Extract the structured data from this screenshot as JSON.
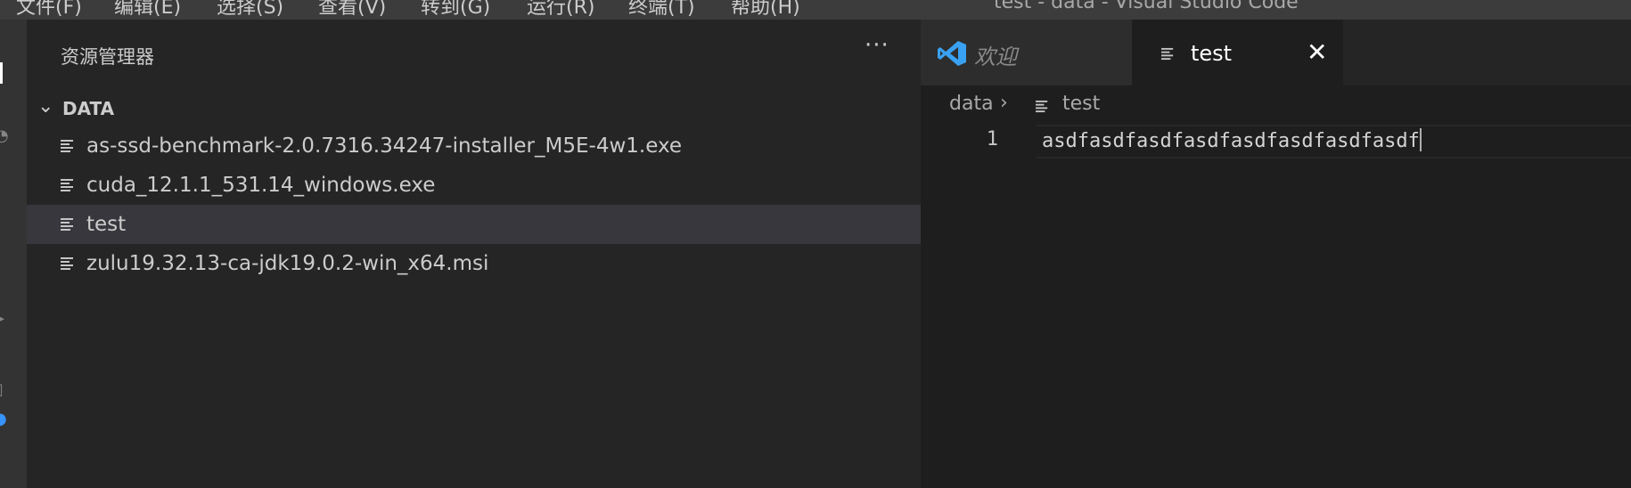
{
  "window": {
    "title": "test - data - Visual Studio Code",
    "menu": [
      "文件(F)",
      "编辑(E)",
      "选择(S)",
      "查看(V)",
      "转到(G)",
      "运行(R)",
      "终端(T)",
      "帮助(H)"
    ]
  },
  "sidebar": {
    "title": "资源管理器",
    "more_icon": "ellipsis-icon",
    "section": "DATA",
    "files": [
      {
        "name": "as-ssd-benchmark-2.0.7316.34247-installer_M5E-4w1.exe",
        "selected": false
      },
      {
        "name": "cuda_12.1.1_531.14_windows.exe",
        "selected": false
      },
      {
        "name": "test",
        "selected": true
      },
      {
        "name": "zulu19.32.13-ca-jdk19.0.2-win_x64.msi",
        "selected": false
      }
    ]
  },
  "tabs": [
    {
      "label": "欢迎",
      "icon": "vscode-icon",
      "active": false
    },
    {
      "label": "test",
      "icon": "file-lines-icon",
      "active": true
    }
  ],
  "breadcrumb": {
    "folder": "data",
    "file": "test"
  },
  "editor": {
    "lines": [
      {
        "number": "1",
        "text": "asdfasdfasdfasdfasdfasdfasdfasdf"
      }
    ]
  },
  "colors": {
    "accent": "#007acc",
    "selection": "#37373d",
    "sidebar_bg": "#252526",
    "editor_bg": "#1e1e1e"
  }
}
